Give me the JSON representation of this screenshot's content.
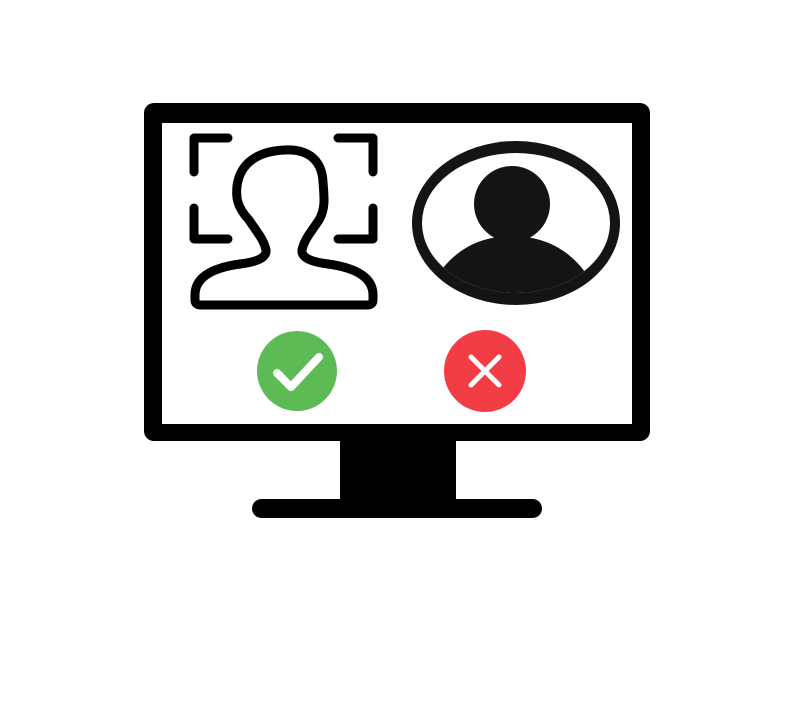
{
  "illustration": {
    "subject": "monitor-face-verification",
    "icons": [
      "monitor-icon",
      "face-scan-icon",
      "user-avatar-icon",
      "checkmark-icon",
      "cross-icon"
    ]
  },
  "colors": {
    "outline": "#000000",
    "avatar_fill": "#141414",
    "screen": "#ffffff",
    "accept": "#5cbb55",
    "reject": "#f23d44",
    "symbol": "#ffffff"
  }
}
